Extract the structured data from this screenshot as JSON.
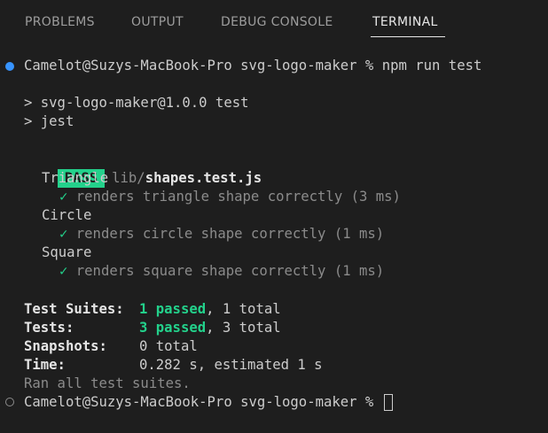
{
  "panel": {
    "tabs": [
      {
        "label": "PROBLEMS"
      },
      {
        "label": "OUTPUT"
      },
      {
        "label": "DEBUG CONSOLE"
      },
      {
        "label": "TERMINAL"
      }
    ],
    "active_tab": "TERMINAL"
  },
  "terminal": {
    "prompt_command": "Camelot@Suzys-MacBook-Pro svg-logo-maker % npm run test",
    "script_line1": "> svg-logo-maker@1.0.0 test",
    "script_line2": "> jest",
    "pass_badge": "PASS",
    "test_file_dir": "lib/",
    "test_file_name": "shapes.test.js",
    "groups": [
      {
        "name": "Triangle",
        "check": "✓",
        "test": "renders triangle shape correctly (3 ms)"
      },
      {
        "name": "Circle",
        "check": "✓",
        "test": "renders circle shape correctly (1 ms)"
      },
      {
        "name": "Square",
        "check": "✓",
        "test": "renders square shape correctly (1 ms)"
      }
    ],
    "summary": {
      "suites_label": "Test Suites:",
      "suites_passed": "1 passed",
      "suites_total": ", 1 total",
      "tests_label": "Tests:",
      "tests_passed": "3 passed",
      "tests_total": ", 3 total",
      "snapshots_label": "Snapshots:",
      "snapshots_value": "0 total",
      "time_label": "Time:",
      "time_value": "0.282 s, estimated 1 s",
      "ran_all": "Ran all test suites."
    },
    "final_prompt": "Camelot@Suzys-MacBook-Pro svg-logo-maker % ",
    "colors": {
      "pass": "#23d18b",
      "success_dot": "#3794ff",
      "background": "#1e1e1e"
    }
  }
}
